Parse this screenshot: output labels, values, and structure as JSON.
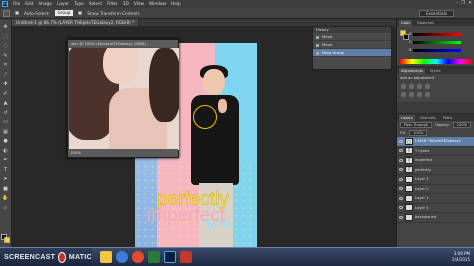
{
  "menubar": {
    "logo": "Ps",
    "items": [
      "File",
      "Edit",
      "Image",
      "Layer",
      "Type",
      "Select",
      "Filter",
      "3D",
      "View",
      "Window",
      "Help"
    ],
    "win_controls": [
      "–",
      "❐",
      "✕"
    ]
  },
  "options": {
    "auto_select_label": "Auto-Select:",
    "auto_select_value": "Group",
    "transform_label": "Show Transform Controls",
    "workspace": "Essentials"
  },
  "tabs": [
    {
      "label": "Untitled-1 @ 66.7% (LAYER THEpHoTEGalaxy2, RGB/8) *"
    },
    {
      "label": "wer @ 100% (Layer 1, RGB/8) *"
    }
  ],
  "photo_window": {
    "title": "wer @ 100% (MyopHoTEGalaxy) (GB/8)",
    "status": "100%"
  },
  "history": {
    "title": "History",
    "rows": [
      "Move",
      "Move",
      "Drop Group"
    ],
    "selected_index": 2
  },
  "poster_words": {
    "line1": "perfectly",
    "line2": "imperfect",
    "line3": "hyoho"
  },
  "right_panels": {
    "color_tabs": [
      "Color",
      "Swatches"
    ],
    "color_labels": [
      "R",
      "G",
      "B"
    ],
    "adjust_tabs": [
      "Adjustments",
      "Styles"
    ],
    "adjust_title": "Add an adjustment",
    "layer_tabs": [
      "Layers",
      "Channels",
      "Paths"
    ],
    "blend_mode": "Pass Through",
    "opacity_label": "Opacity:",
    "opacity_value": "100%",
    "fill_label": "Fill:",
    "fill_value": "100%",
    "layers": [
      {
        "name": "LAYER THEpHoTEGalaxy2",
        "thumb": "□",
        "selected": true
      },
      {
        "name": "T hyoho",
        "thumb": "T",
        "selected": false
      },
      {
        "name": "imperfect",
        "thumb": "T",
        "selected": false
      },
      {
        "name": "perfectly",
        "thumb": "T",
        "selected": false
      },
      {
        "name": "Layer 3",
        "thumb": "",
        "selected": false
      },
      {
        "name": "Layer 2",
        "thumb": "",
        "selected": false
      },
      {
        "name": "Layer 1",
        "thumb": "",
        "selected": false
      },
      {
        "name": "Layer 4",
        "thumb": "",
        "selected": false
      },
      {
        "name": "background",
        "thumb": "",
        "selected": false
      }
    ]
  },
  "taskbar": {
    "brand_left": "SCREENCAST",
    "brand_right": "MATIC",
    "time": "3:00 PM",
    "date": "2/4/2015"
  },
  "colors": {
    "accent": "#5f7fa8",
    "poster_yellow": "#ffe34a",
    "poster_pink": "#f3a9b8",
    "poster_blue": "#8de3f6"
  }
}
